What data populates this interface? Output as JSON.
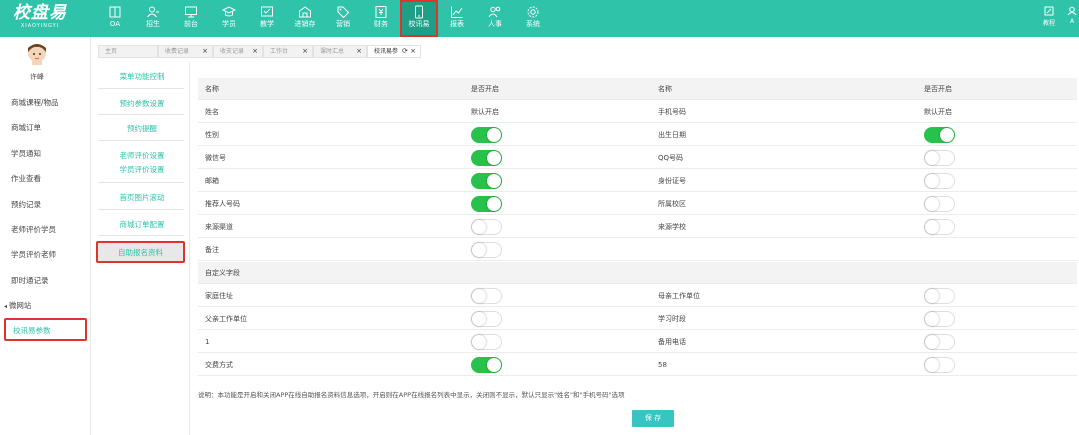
{
  "logo": {
    "cn": "校盘易",
    "en": "XIAOYINGYI"
  },
  "nav": [
    {
      "label": "OA",
      "icon": "book-icon"
    },
    {
      "label": "招生",
      "icon": "user-add-icon"
    },
    {
      "label": "前台",
      "icon": "monitor-icon"
    },
    {
      "label": "学员",
      "icon": "graduation-cap-icon"
    },
    {
      "label": "教学",
      "icon": "teaching-icon"
    },
    {
      "label": "进销存",
      "icon": "warehouse-icon"
    },
    {
      "label": "营销",
      "icon": "tag-icon"
    },
    {
      "label": "财务",
      "icon": "finance-icon"
    },
    {
      "label": "校讯易",
      "icon": "phone-icon"
    },
    {
      "label": "报表",
      "icon": "chart-icon"
    },
    {
      "label": "人事",
      "icon": "people-icon"
    },
    {
      "label": "系统",
      "icon": "gear-icon"
    }
  ],
  "top_right": [
    {
      "label": "教程"
    },
    {
      "label": "A"
    }
  ],
  "sidebar": {
    "username": "许峰",
    "items": [
      "商城课程/物品",
      "商城订单",
      "学员通知",
      "作业查看",
      "预约记录",
      "老师评价学员",
      "学员评价老师",
      "即时通记录",
      "微网站",
      "校讯易参数"
    ]
  },
  "tabs": [
    "主页",
    "收费记录",
    "收支记录",
    "工作台",
    "课时汇总",
    "校讯易参"
  ],
  "submenu": [
    "菜单功能控制",
    "预约参数设置",
    "预约提醒",
    "老师评价设置",
    "学员评价设置",
    "首页图片滚动",
    "商城订单配置",
    "自助报名资料"
  ],
  "table": {
    "headers": {
      "name": "名称",
      "enabled": "是否开启"
    },
    "default_on": "默认开启",
    "rows": [
      {
        "left": "姓名",
        "left_state": "default",
        "right": "手机号码",
        "right_state": "default"
      },
      {
        "left": "性别",
        "left_state": "on",
        "right": "出生日期",
        "right_state": "on"
      },
      {
        "left": "微信号",
        "left_state": "on",
        "right": "QQ号码",
        "right_state": "off"
      },
      {
        "left": "邮箱",
        "left_state": "on",
        "right": "身份证号",
        "right_state": "off"
      },
      {
        "left": "推荐人号码",
        "left_state": "on",
        "right": "所属校区",
        "right_state": "off"
      },
      {
        "left": "来源渠道",
        "left_state": "off",
        "right": "来源学校",
        "right_state": "off"
      },
      {
        "left": "备注",
        "left_state": "off",
        "right": "",
        "right_state": "none"
      }
    ],
    "section_title": "自定义字段",
    "custom_rows": [
      {
        "left": "家庭住址",
        "left_state": "off",
        "right": "母亲工作单位",
        "right_state": "off"
      },
      {
        "left": "父亲工作单位",
        "left_state": "off",
        "right": "学习时段",
        "right_state": "off"
      },
      {
        "left": "1",
        "left_state": "off",
        "right": "备用电话",
        "right_state": "off"
      },
      {
        "left": "交费方式",
        "left_state": "on",
        "right": "58",
        "right_state": "off"
      }
    ]
  },
  "note": "说明：本功能是开启和关闭APP在线自助报名资料信息选项，开启则在APP在线报名列表中显示，关闭则不显示，默认只显示\"姓名\"和\"手机号码\"选项",
  "save_label": "保 存",
  "colors": {
    "brand": "#2fc3aa",
    "toggle_on": "#27c24c",
    "highlight": "#e0322f"
  }
}
